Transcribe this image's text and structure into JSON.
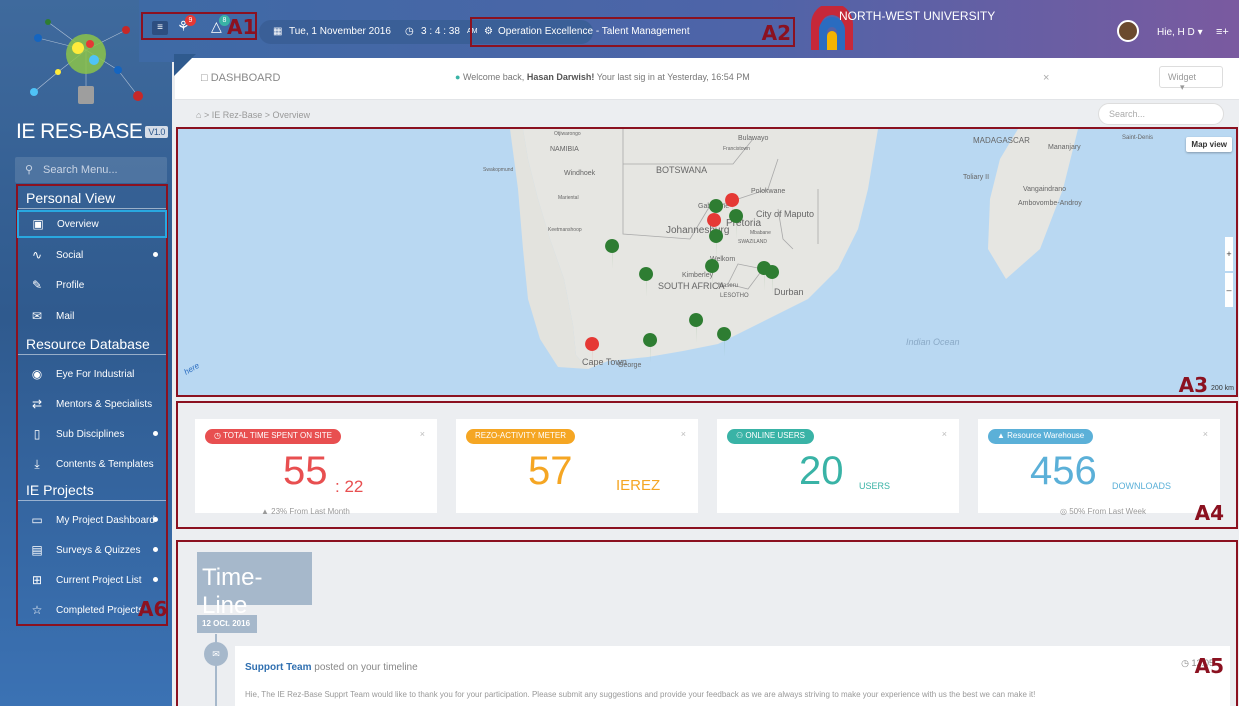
{
  "sidebar": {
    "title": "IE RES-BASE",
    "version": "V1.0",
    "search_placeholder": "Search Menu...",
    "sections": [
      {
        "title": "Personal View"
      },
      {
        "title": "Resource Database"
      },
      {
        "title": "IE Projects"
      }
    ],
    "items": [
      {
        "label": "Overview",
        "icon": "window-icon",
        "active": true
      },
      {
        "label": "Social",
        "icon": "rss-icon",
        "dot": true
      },
      {
        "label": "Profile",
        "icon": "edit-icon"
      },
      {
        "label": "Mail",
        "icon": "envelope-icon"
      },
      {
        "label": "Eye For Industrial",
        "icon": "camera-icon"
      },
      {
        "label": "Mentors & Specialists",
        "icon": "shuffle-icon"
      },
      {
        "label": "Sub Disciplines",
        "icon": "document-icon",
        "dot": true
      },
      {
        "label": "Contents & Templates",
        "icon": "download-icon"
      },
      {
        "label": "My Project Dashboard",
        "icon": "monitor-icon",
        "dot": true
      },
      {
        "label": "Surveys & Quizzes",
        "icon": "list-icon",
        "dot": true
      },
      {
        "label": "Current Project List",
        "icon": "grid-icon",
        "dot": true
      },
      {
        "label": "Completed Projects",
        "icon": "star-icon"
      }
    ]
  },
  "topbar": {
    "badge1": "9",
    "badge2": "8",
    "date": "Tue, 1 November 2016",
    "time": "3 : 4 : 38",
    "time_suffix": "AM",
    "context": "Operation Excellence - Talent Management",
    "university": "NORTH-WEST UNIVERSITY",
    "user": "Hie, H D",
    "accent": "#3e6aa5"
  },
  "dashboard": {
    "title": "DASHBOARD",
    "welcome_prefix": "Welcome back,",
    "welcome_name": "Hasan Darwish!",
    "welcome_suffix": "Your last sig in at Yesterday, 16:54 PM",
    "widget_label": "Widget",
    "breadcrumb": "IE Rez-Base  >  Overview",
    "search_placeholder": "Search..."
  },
  "map": {
    "view_label": "Map view",
    "scale": "200 km",
    "labels": [
      "NAMIBIA",
      "BOTSWANA",
      "Windhoek",
      "Bulawayo",
      "Francistown",
      "Polokwane",
      "Gaborone",
      "Pretoria",
      "Johannesburg",
      "City of Maputo",
      "SWAZILAND",
      "Welkom",
      "Kimberley",
      "SOUTH AFRICA",
      "Maseru",
      "LESOTHO",
      "Durban",
      "Cape Town",
      "George",
      "MADAGASCAR",
      "Mananjary",
      "Toliary II",
      "Vangaindrano",
      "Ambovombe-Androy",
      "Indian Ocean",
      "Keetmanshoop",
      "Mariental",
      "Swakopmund",
      "Otjiwarongo",
      "Mbabane",
      "Saint-Denis"
    ],
    "pin_green": "#2e7d32",
    "pin_red": "#e53935"
  },
  "stats": [
    {
      "label": "TOTAL TIME SPENT ON SITE",
      "value": "55",
      "suffix": ": 22",
      "foot": "23% From Last Month",
      "color": "#e84f50"
    },
    {
      "label": "REZO-ACTIVITY METER",
      "value": "57",
      "suffix": "IEREZ",
      "foot": "",
      "color": "#f5a623"
    },
    {
      "label": "ONLINE USERS",
      "value": "20",
      "suffix": "USERS",
      "foot": "",
      "color": "#39b3a6"
    },
    {
      "label": "Resource Warehouse",
      "value": "456",
      "suffix": "DOWNLOADS",
      "foot": "50% From Last Week",
      "color": "#5bb0d8"
    }
  ],
  "timeline": {
    "title": "Time-Line",
    "date": "12 OCt. 2016",
    "author": "Support Team",
    "action": "posted on your timeline",
    "time": "12:05",
    "message": "Hie, The IE Rez-Base Supprt Team would like to thank you for your participation. Please submit any suggestions and provide your feedback as we are always striving to make your experience with us the best we can make it!"
  },
  "annotations": {
    "a1": "A1",
    "a2": "A2",
    "a3": "A3",
    "a4": "A4",
    "a5": "A5",
    "a6": "A6"
  }
}
